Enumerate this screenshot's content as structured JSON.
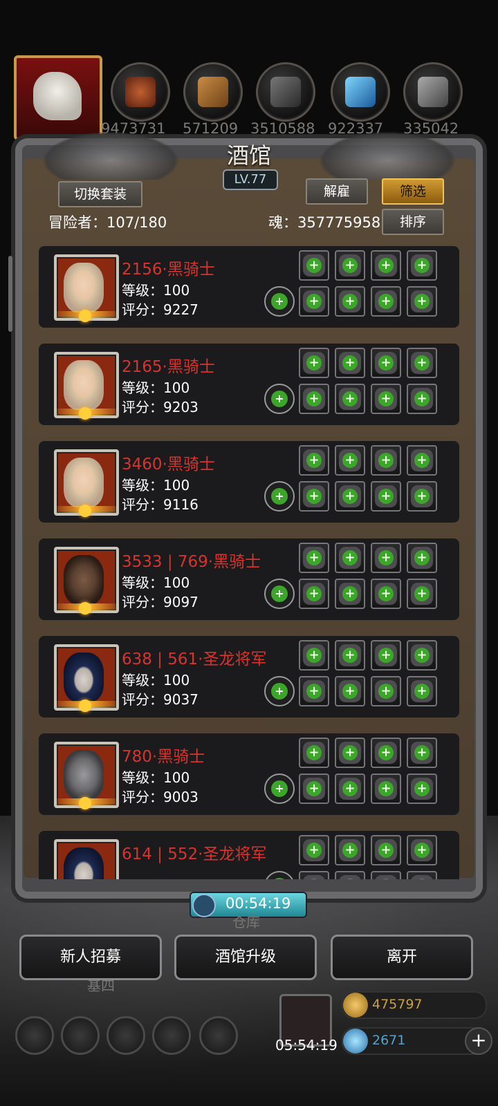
{
  "resources": {
    "values": [
      "9473731",
      "571209",
      "3510588",
      "922337",
      "335042"
    ]
  },
  "header": {
    "title": "酒馆",
    "level": "LV.77",
    "switch_outfit": "切换套装",
    "dismiss": "解雇",
    "filter": "筛选",
    "adventurers_label": "冒险者：107/180",
    "soul_label": "魂：357775958",
    "sort": "排序"
  },
  "heroes": [
    {
      "name": "2156·黑骑士",
      "level": "等级：100",
      "score": "评分：9227",
      "face": "f"
    },
    {
      "name": "2165·黑骑士",
      "level": "等级：100",
      "score": "评分：9203",
      "face": "f"
    },
    {
      "name": "3460·黑骑士",
      "level": "等级：100",
      "score": "评分：9116",
      "face": "f"
    },
    {
      "name": "3533 | 769·黑骑士",
      "level": "等级：100",
      "score": "评分：9097",
      "face": "m"
    },
    {
      "name": "638 | 561·圣龙将军",
      "level": "等级：100",
      "score": "评分：9037",
      "face": "b"
    },
    {
      "name": "780·黑骑士",
      "level": "等级：100",
      "score": "评分：9003",
      "face": "k"
    },
    {
      "name": "614 | 552·圣龙将军",
      "level": "",
      "score": "",
      "face": "b"
    }
  ],
  "timer": "00:54:19",
  "actions": {
    "recruit": "新人招募",
    "upgrade": "酒馆升级",
    "leave": "离开"
  },
  "bottom": {
    "gift_timer": "05:54:19",
    "gold": "475797",
    "gems": "2671",
    "ghost_left": "基四",
    "ghost_mid": "仓库"
  },
  "colors": {
    "name_red": "#d8332f",
    "accent_gold": "#d09a32",
    "plus_green": "#3ca62a"
  }
}
